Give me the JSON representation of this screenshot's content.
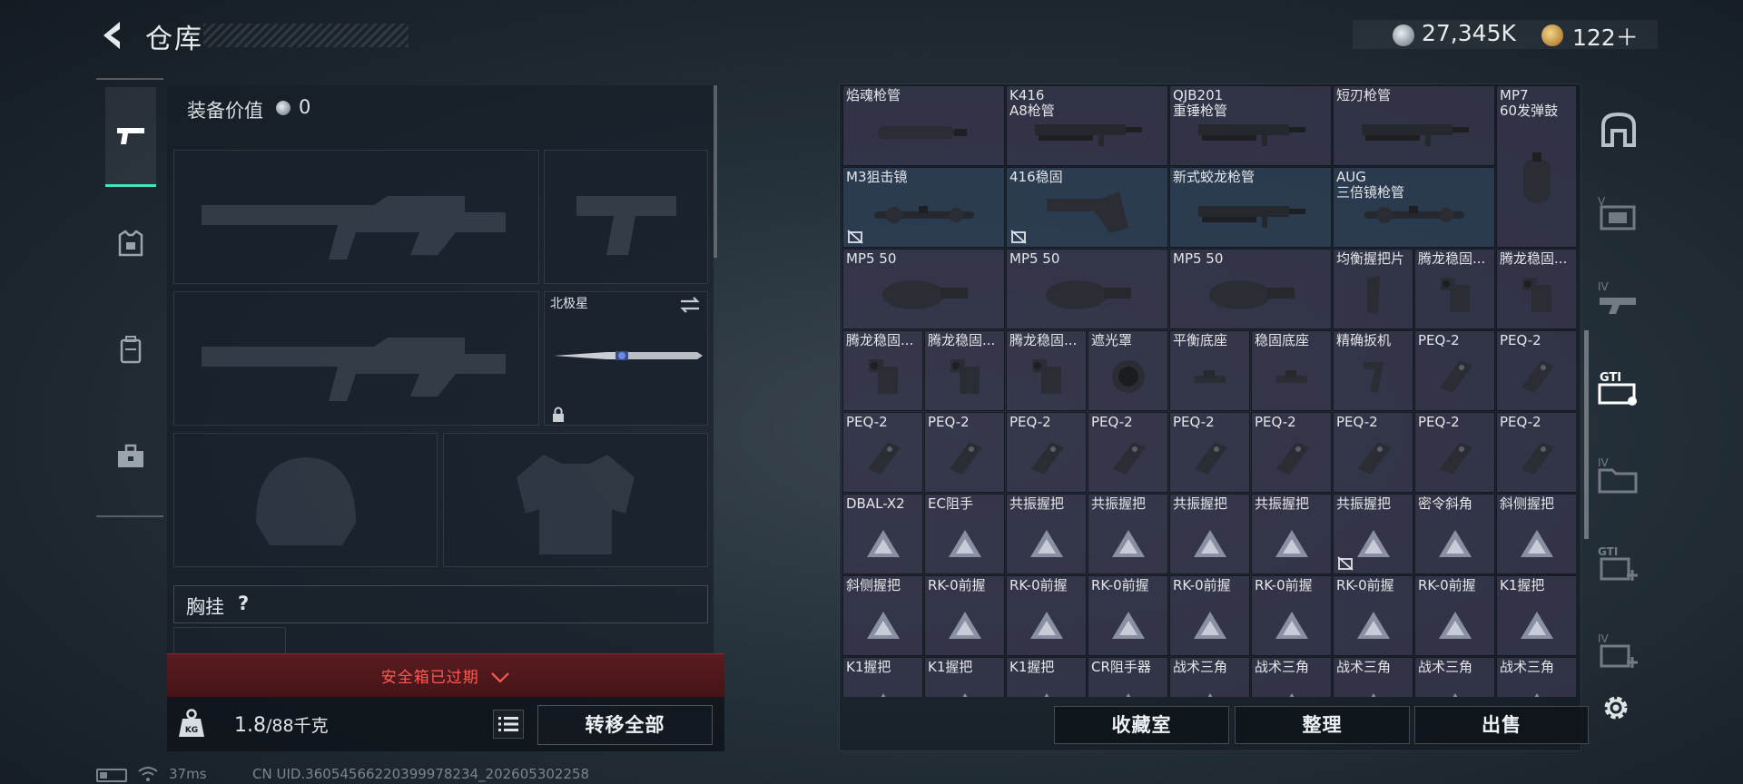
{
  "header": {
    "title": "仓库",
    "currency_silver": "27,345K",
    "currency_gold": "122＋"
  },
  "equipment": {
    "value_label": "装备价值",
    "value": "0",
    "melee_name": "北极星",
    "chest_rig_label": "胸挂",
    "chest_rig_help": "?",
    "safe_box_status": "安全箱已过期",
    "weight_current": "1.8",
    "weight_max": "/88千克",
    "transfer_all_label": "转移全部"
  },
  "status": {
    "ping": "37ms",
    "uid": "CN UID.3605456622039997823​4_202605302258"
  },
  "inventory": {
    "items": [
      {
        "label": "焰魂枪管",
        "icon": "suppressor"
      },
      {
        "label": "K416\nA8枪管",
        "icon": "rail"
      },
      {
        "label": "QJB201\n重锤枪管",
        "icon": "rail"
      },
      {
        "label": "短刃枪管",
        "icon": "rail"
      },
      {
        "label": "MP7\n60发弹鼓",
        "icon": "drum-mag"
      },
      {
        "label": "M3狙击镜",
        "icon": "scope",
        "unboxed": true
      },
      {
        "label": "416稳固",
        "icon": "stock",
        "unboxed": true
      },
      {
        "label": "新式蛟龙枪管",
        "icon": "rail"
      },
      {
        "label": "AUG\n三倍镜枪管",
        "icon": "scope"
      },
      {
        "label": "MP5 50",
        "icon": "drum"
      },
      {
        "label": "MP5 50",
        "icon": "drum"
      },
      {
        "label": "MP5 50",
        "icon": "drum"
      },
      {
        "label": "均衡握把片",
        "icon": "grip-panel"
      },
      {
        "label": "腾龙稳固...",
        "icon": "stock-small"
      },
      {
        "label": "腾龙稳固...",
        "icon": "stock-small"
      },
      {
        "label": "腾龙稳固...",
        "icon": "stock-small"
      },
      {
        "label": "腾龙稳固...",
        "icon": "stock-small"
      },
      {
        "label": "腾龙稳固...",
        "icon": "stock-small"
      },
      {
        "label": "遮光罩",
        "icon": "hood"
      },
      {
        "label": "平衡底座",
        "icon": "mount"
      },
      {
        "label": "稳固底座",
        "icon": "mount"
      },
      {
        "label": "精确扳机",
        "icon": "trigger"
      },
      {
        "label": "PEQ-2",
        "icon": "laser"
      },
      {
        "label": "PEQ-2",
        "icon": "laser"
      },
      {
        "label": "PEQ-2",
        "icon": "laser"
      },
      {
        "label": "PEQ-2",
        "icon": "laser"
      },
      {
        "label": "PEQ-2",
        "icon": "laser"
      },
      {
        "label": "PEQ-2",
        "icon": "laser"
      },
      {
        "label": "PEQ-2",
        "icon": "laser"
      },
      {
        "label": "PEQ-2",
        "icon": "laser"
      },
      {
        "label": "PEQ-2",
        "icon": "laser"
      },
      {
        "label": "PEQ-2",
        "icon": "laser"
      },
      {
        "label": "PEQ-2",
        "icon": "laser"
      },
      {
        "label": "DBAL-X2",
        "icon": "placeholder"
      },
      {
        "label": "EC阻手",
        "icon": "placeholder"
      },
      {
        "label": "共振握把",
        "icon": "placeholder"
      },
      {
        "label": "共振握把",
        "icon": "placeholder"
      },
      {
        "label": "共振握把",
        "icon": "placeholder"
      },
      {
        "label": "共振握把",
        "icon": "placeholder"
      },
      {
        "label": "共振握把",
        "icon": "placeholder",
        "unboxed": true
      },
      {
        "label": "密令斜角",
        "icon": "placeholder"
      },
      {
        "label": "斜侧握把",
        "icon": "placeholder"
      },
      {
        "label": "斜侧握把",
        "icon": "placeholder"
      },
      {
        "label": "RK-0前握",
        "icon": "placeholder"
      },
      {
        "label": "RK-0前握",
        "icon": "placeholder"
      },
      {
        "label": "RK-0前握",
        "icon": "placeholder"
      },
      {
        "label": "RK-0前握",
        "icon": "placeholder"
      },
      {
        "label": "RK-0前握",
        "icon": "placeholder"
      },
      {
        "label": "RK-0前握",
        "icon": "placeholder"
      },
      {
        "label": "RK-0前握",
        "icon": "placeholder"
      },
      {
        "label": "K1握把",
        "icon": "placeholder"
      },
      {
        "label": "K1握把",
        "icon": "placeholder"
      },
      {
        "label": "K1握把",
        "icon": "placeholder"
      },
      {
        "label": "K1握把",
        "icon": "placeholder"
      },
      {
        "label": "CR阻手器",
        "icon": "placeholder"
      },
      {
        "label": "战术三角",
        "icon": "placeholder"
      },
      {
        "label": "战术三角",
        "icon": "placeholder"
      },
      {
        "label": "战术三角",
        "icon": "placeholder"
      },
      {
        "label": "战术三角",
        "icon": "placeholder"
      },
      {
        "label": "战术三角",
        "icon": "placeholder"
      }
    ]
  },
  "actions": {
    "collection_label": "收藏室",
    "sort_label": "整理",
    "sell_label": "出售"
  },
  "colors": {
    "accent": "#3ee6c0",
    "warning": "#ff5a50",
    "cell": "#3c3a52"
  }
}
